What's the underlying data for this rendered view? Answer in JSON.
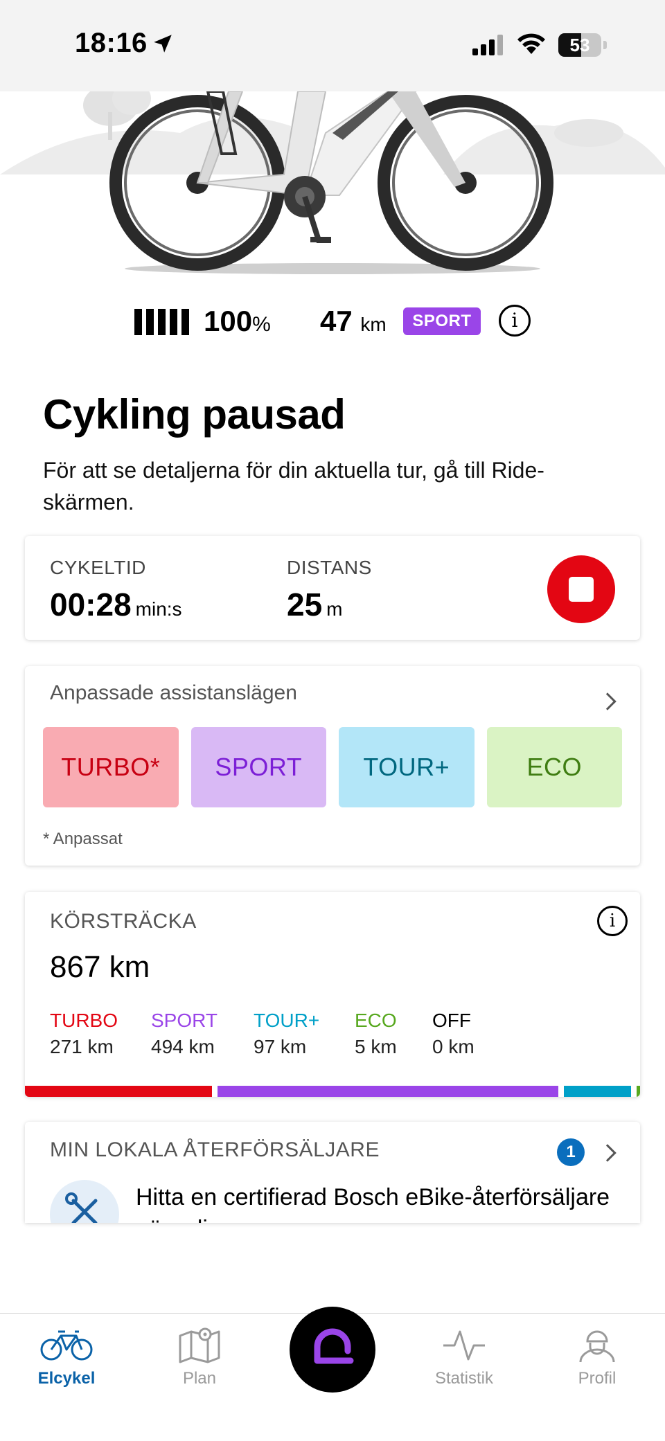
{
  "status_bar": {
    "time": "18:16",
    "battery_level": "53",
    "battery_fraction": 0.53
  },
  "bike": {
    "battery_percent": "100",
    "percent_unit": "%",
    "range_value": "47",
    "range_unit": "km",
    "assist_mode": "SPORT"
  },
  "ride": {
    "title": "Cykling pausad",
    "description": "För att se detaljerna för din aktuella tur, gå till Ride-skärmen.",
    "time_label": "CYKELTID",
    "time_value": "00:28",
    "time_unit": "min:s",
    "distance_label": "DISTANS",
    "distance_value": "25",
    "distance_unit": "m"
  },
  "assist_modes": {
    "title": "Anpassade assistanslägen",
    "modes": [
      "TURBO*",
      "SPORT",
      "TOUR+",
      "ECO"
    ],
    "footnote": "* Anpassat"
  },
  "odometer": {
    "title": "KÖRSTRÄCKA",
    "total": "867 km",
    "breakdown": [
      {
        "name": "TURBO",
        "value": "271 km",
        "km": 271,
        "color": "#e30613"
      },
      {
        "name": "SPORT",
        "value": "494 km",
        "km": 494,
        "color": "#9a45e8"
      },
      {
        "name": "TOUR+",
        "value": "97 km",
        "km": 97,
        "color": "#00a0c8"
      },
      {
        "name": "ECO",
        "value": "5 km",
        "km": 5,
        "color": "#57a81e"
      },
      {
        "name": "OFF",
        "value": "0 km",
        "km": 0,
        "color": "#000000"
      }
    ]
  },
  "dealer": {
    "title": "MIN LOKALA ÅTERFÖRSÄLJARE",
    "badge": "1",
    "text": "Hitta en certifierad Bosch eBike-återförsäljare nära dig"
  },
  "nav": {
    "items": [
      "Elcykel",
      "Plan",
      "Statistik",
      "Profil"
    ],
    "active": "Elcykel"
  }
}
